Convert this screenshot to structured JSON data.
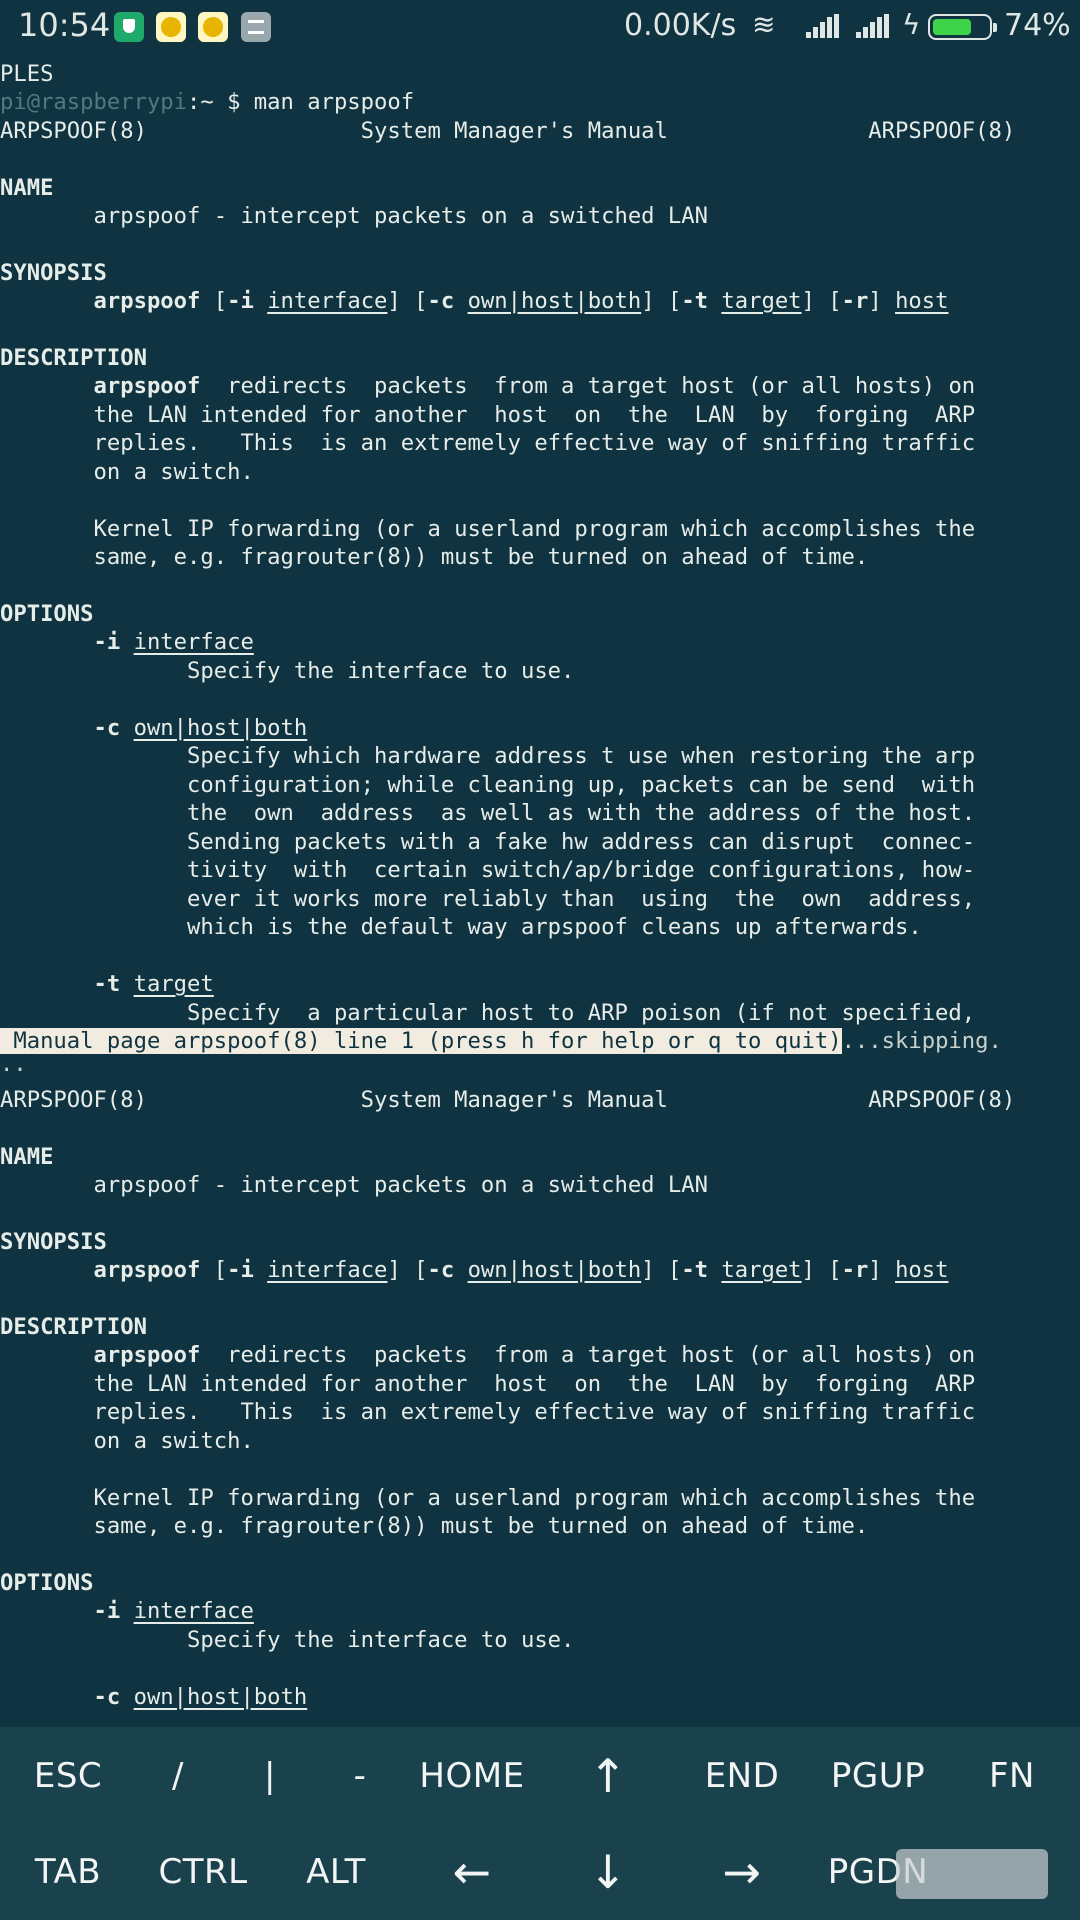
{
  "status_bar": {
    "time": "10:54",
    "net_speed": "0.00K/s",
    "battery_percent": "74%",
    "battery_level": 0.74,
    "icons": [
      "shield-icon",
      "coin-icon",
      "coin-icon",
      "gallery-icon",
      "wifi-icon",
      "signal-icon",
      "signal-icon",
      "charging-icon",
      "battery-icon"
    ],
    "wifi_glyph": "≋",
    "bolt_glyph": "ϟ"
  },
  "terminal": {
    "top_pane": {
      "ples": "PLES",
      "prompt_user": "pi@raspberrypi",
      "prompt_rest": ":~ $ man arpspoof",
      "header": "ARPSPOOF(8)                System Manager's Manual               ARPSPOOF(8)",
      "name_h": "NAME",
      "name_text": "       arpspoof - intercept packets on a switched LAN",
      "syn_h": "SYNOPSIS",
      "syn": [
        "       ",
        "arpspoof",
        " [",
        "-i",
        " ",
        "interface",
        "] [",
        "-c",
        " ",
        "own|host|both",
        "] [",
        "-t",
        " ",
        "target",
        "] [",
        "-r",
        "] ",
        "host"
      ],
      "desc_h": "DESCRIPTION",
      "desc1_b": "arpspoof",
      "desc1_rest": "  redirects  packets  from a target host (or all hosts) on",
      "desc2": "       the LAN intended for another  host  on  the  LAN  by  forging  ARP",
      "desc3": "       replies.   This  is an extremely effective way of sniffing traffic",
      "desc4": "       on a switch.",
      "kern1": "       Kernel IP forwarding (or a userland program which accomplishes the",
      "kern2": "       same, e.g. fragrouter(8)) must be turned on ahead of time.",
      "opt_h": "OPTIONS",
      "opt_i_flag": "-i",
      "opt_i_arg": "interface",
      "opt_i_desc": "              Specify the interface to use.",
      "opt_c_flag": "-c",
      "opt_c_arg": "own|host|both",
      "opt_c_desc": [
        "              Specify which hardware address t use when restoring the arp",
        "              configuration; while cleaning up, packets can be send  with",
        "              the  own  address  as well as with the address of the host.",
        "              Sending packets with a fake hw address can disrupt  connec‐",
        "              tivity  with  certain switch/ap/bridge configurations, how‐",
        "              ever it works more reliably than  using  the  own  address,",
        "              which is the default way arpspoof cleans up afterwards."
      ],
      "opt_t_flag": "-t",
      "opt_t_arg": "target",
      "opt_t_desc": "              Specify  a particular host to ARP poison (if not specified,"
    },
    "status_line": " Manual page arpspoof(8) line 1 (press h for help or q to quit)",
    "skipping": "...skipping.",
    "dots": "..",
    "bottom_pane": {
      "header": "ARPSPOOF(8)                System Manager's Manual               ARPSPOOF(8)",
      "name_h": "NAME",
      "name_text": "       arpspoof - intercept packets on a switched LAN",
      "syn_h": "SYNOPSIS",
      "desc_h": "DESCRIPTION",
      "desc1_b": "arpspoof",
      "desc1_rest": "  redirects  packets  from a target host (or all hosts) on",
      "desc2": "       the LAN intended for another  host  on  the  LAN  by  forging  ARP",
      "desc3": "       replies.   This  is an extremely effective way of sniffing traffic",
      "desc4": "       on a switch.",
      "kern1": "       Kernel IP forwarding (or a userland program which accomplishes the",
      "kern2": "       same, e.g. fragrouter(8)) must be turned on ahead of time.",
      "opt_h": "OPTIONS",
      "opt_i_flag": "-i",
      "opt_i_arg": "interface",
      "opt_i_desc": "              Specify the interface to use.",
      "opt_c_flag": "-c",
      "opt_c_arg": "own|host|both"
    }
  },
  "extra_keys": {
    "row1": [
      "ESC",
      "/",
      "|",
      "-",
      "HOME",
      "↑",
      "END",
      "PGUP",
      "FN"
    ],
    "row2": [
      "TAB",
      "CTRL",
      "ALT",
      "←",
      "↓",
      "→",
      "PGDN"
    ]
  }
}
